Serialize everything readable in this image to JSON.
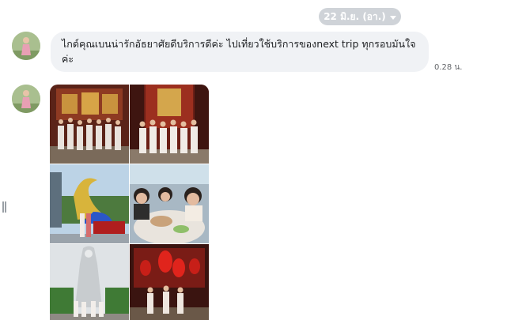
{
  "date_separator": {
    "label": "22 มิ.ย. (อา.)",
    "icon": "caret-down-icon"
  },
  "messages": [
    {
      "text": "ไกด์คุณเบนน่ารักอัธยาศัยดีบริการดีค่ะ ไปเที่ยวใช้บริการของnext trip ทุกรอบมันใจค่ะ",
      "time": "0.28 น."
    }
  ],
  "photo_album": {
    "photos": [
      {
        "name": "group-photo-temple-interior"
      },
      {
        "name": "group-photo-temple-gate"
      },
      {
        "name": "golden-naga-statue-photo"
      },
      {
        "name": "restaurant-selfie-photo"
      },
      {
        "name": "white-guanyin-statue-photo"
      },
      {
        "name": "red-lantern-shrine-photo"
      }
    ]
  }
}
